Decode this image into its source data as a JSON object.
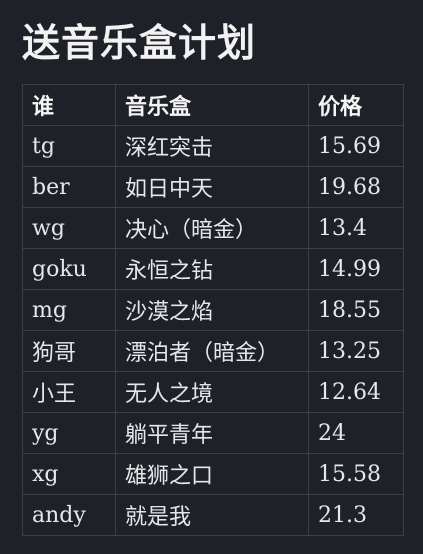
{
  "page": {
    "title": "送音乐盒计划"
  },
  "table": {
    "headers": [
      "谁",
      "音乐盒",
      "价格"
    ],
    "rows": [
      [
        "tg",
        "深红突击",
        "15.69"
      ],
      [
        "ber",
        "如日中天",
        "19.68"
      ],
      [
        "wg",
        "决心（暗金）",
        "13.4"
      ],
      [
        "goku",
        "永恒之钻",
        "14.99"
      ],
      [
        "mg",
        "沙漠之焰",
        "18.55"
      ],
      [
        "狗哥",
        "漂泊者（暗金）",
        "13.25"
      ],
      [
        "小王",
        "无人之境",
        "12.64"
      ],
      [
        "yg",
        "躺平青年",
        "24"
      ],
      [
        "xg",
        "雄狮之口",
        "15.58"
      ],
      [
        "andy",
        "就是我",
        "21.3"
      ]
    ]
  }
}
